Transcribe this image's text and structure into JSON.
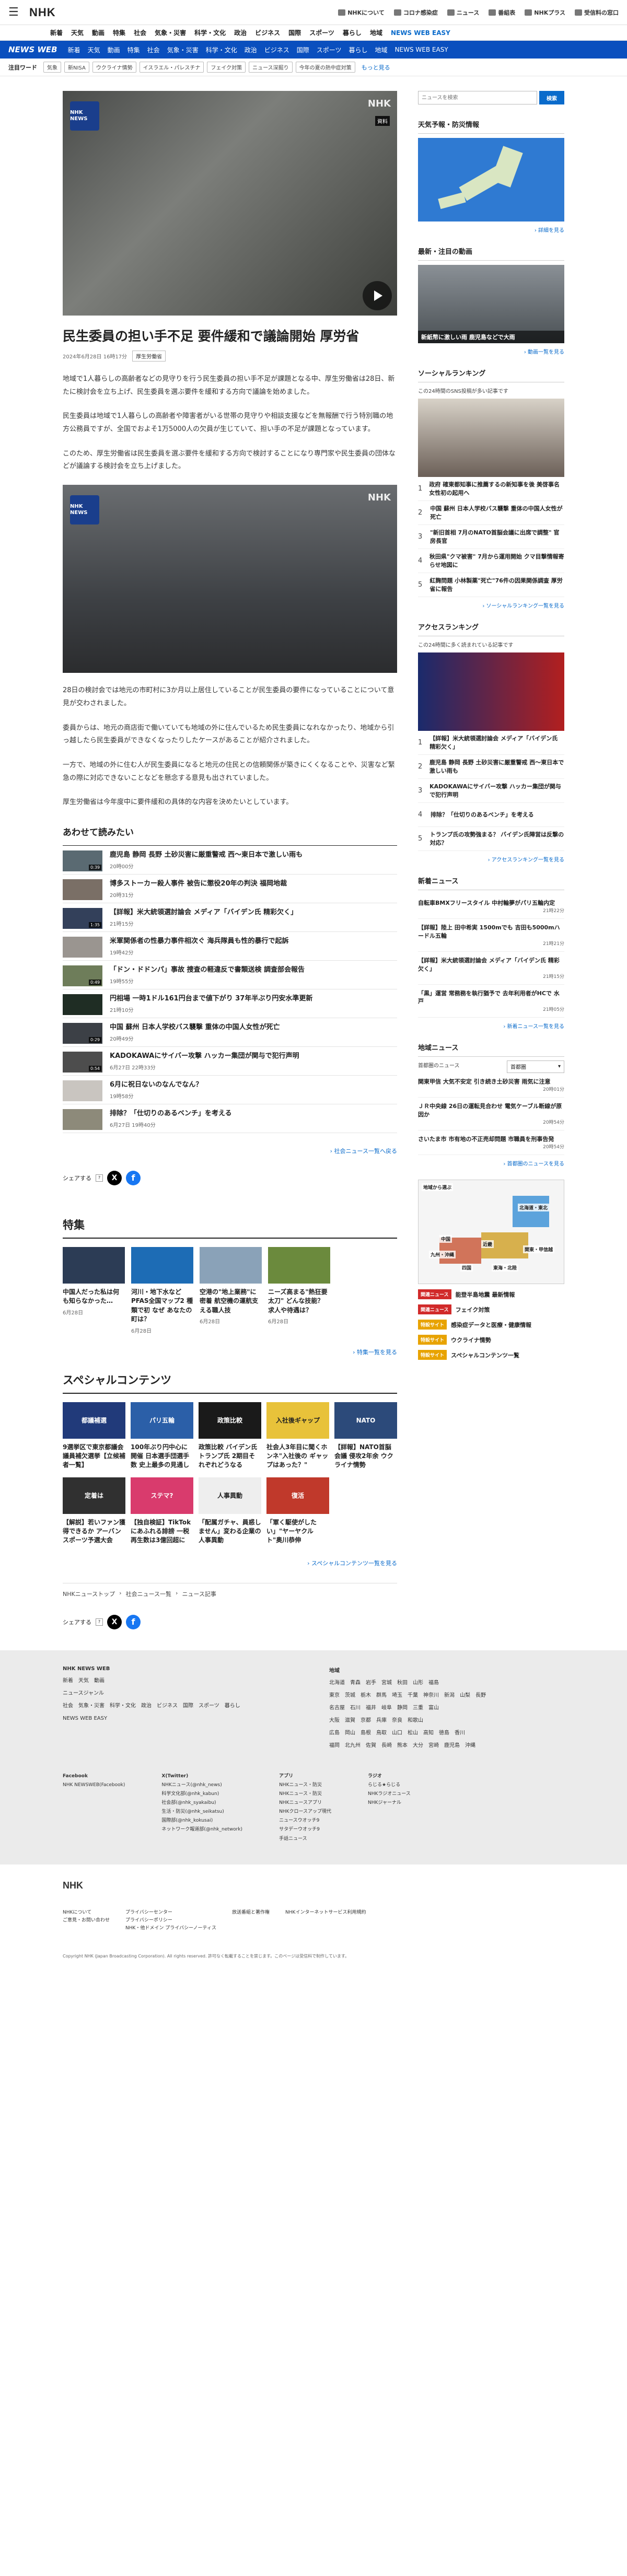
{
  "header": {
    "logo": "NHK",
    "links": [
      "NHKについて",
      "コロナ感染症",
      "ニュース",
      "番組表",
      "NHKプラス",
      "受信料の窓口"
    ]
  },
  "nav": {
    "items": [
      "新着",
      "天気",
      "動画",
      "特集",
      "社会",
      "気象・災害",
      "科学・文化",
      "政治",
      "ビジネス",
      "国際",
      "スポーツ",
      "暮らし",
      "地域",
      "NEWS WEB EASY"
    ]
  },
  "newsweb": {
    "logo": "NEWS WEB",
    "items": [
      "新着",
      "天気",
      "動画",
      "特集",
      "社会",
      "気象・災害",
      "科学・文化",
      "政治",
      "ビジネス",
      "国際",
      "スポーツ",
      "暮らし",
      "地域",
      "NEWS WEB EASY"
    ]
  },
  "attention": {
    "label": "注目ワード",
    "tags": [
      "気象",
      "新NISA",
      "ウクライナ情勢",
      "イスラエル・パレスチナ",
      "フェイク対策",
      "ニュース深掘り",
      "今年の夏の熱中症対策"
    ],
    "more": "もっと見る"
  },
  "article": {
    "watermark": "NHK",
    "badge": "資料",
    "nhk_badge": "NHK NEWS",
    "title": "民生委員の担い手不足 要件緩和で議論開始 厚労省",
    "date": "2024年6月28日 16時17分",
    "category": "厚生労働省",
    "paragraphs": [
      "地域で1人暮らしの高齢者などの見守りを行う民生委員の担い手不足が課題となる中、厚生労働省は28日、新たに検討会を立ち上げ、民生委員を選ぶ要件を緩和する方向で議論を始めました。",
      "民生委員は地域で1人暮らしの高齢者や障害者がいる世帯の見守りや相談支援などを無報酬で行う特別職の地方公務員ですが、全国でおよそ1万5000人の欠員が生じていて、担い手の不足が課題となっています。",
      "このため、厚生労働省は民生委員を選ぶ要件を緩和する方向で検討することになり専門家や民生委員の団体などが議論する検討会を立ち上げました。",
      "28日の検討会では地元の市町村に3か月以上居住していることが民生委員の要件になっていることについて意見が交わされました。",
      "委員からは、地元の商店街で働いていても地域の外に住んでいるため民生委員になれなかったり、地域から引っ越したら民生委員ができなくなったりしたケースがあることが紹介されました。",
      "一方で、地域の外に住む人が民生委員になると地元の住民との信頼関係が築きにくくなることや、災害など緊急の際に対応できないことなどを懸念する意見も出されていました。",
      "厚生労働省は今年度中に要件緩和の具体的な内容を決めたいとしています。"
    ]
  },
  "related": {
    "heading": "あわせて読みたい",
    "items": [
      {
        "title": "鹿児島 静岡 長野 土砂災害に厳重警戒 西～東日本で激しい雨も",
        "date": "20時00分",
        "dur": "0:39"
      },
      {
        "title": "博多ストーカー殺人事件 被告に懲役20年の判決 福岡地裁",
        "date": "20時31分",
        "dur": ""
      },
      {
        "title": "【詳報】米大統領選討論会 メディア「バイデン氏 精彩欠く」",
        "date": "21時15分",
        "dur": "1:35"
      },
      {
        "title": "米軍関係者の性暴力事件相次ぐ 海兵隊員も性的暴行で起訴",
        "date": "19時42分",
        "dur": ""
      },
      {
        "title": "「ドン・ドドンパ」事故 捜査の軽違反で書類送検 調査部会報告",
        "date": "19時55分",
        "dur": "0:49"
      },
      {
        "title": "円相場 一時1ドル161円台まで値下がり 37年半ぶり円安水準更新",
        "date": "21時10分",
        "dur": ""
      },
      {
        "title": "中国 蘇州 日本人学校バス襲撃 重体の中国人女性が死亡",
        "date": "20時49分",
        "dur": "0:29"
      },
      {
        "title": "KADOKAWAにサイバー攻撃 ハッカー集団が関与で犯行声明",
        "date": "6月27日 22時33分",
        "dur": "0:54"
      },
      {
        "title": "6月に祝日ないのなんでなん？",
        "date": "19時58分",
        "dur": ""
      },
      {
        "title": "排除？「仕切りのあるベンチ」を考える",
        "date": "6月27日 19時40分",
        "dur": ""
      }
    ],
    "more": "社会ニュース一覧へ戻る"
  },
  "share": {
    "label": "シェアする"
  },
  "tokushu": {
    "heading": "特集",
    "items": [
      {
        "title": "中国人だった私は何も知らなかった…",
        "date": "6月28日",
        "thumb": "中国"
      },
      {
        "title": "河川・地下水など PFAS全国マップ2 種類で初 なぜ あなたの町は？",
        "date": "6月28日",
        "thumb": "PFAS汚染"
      },
      {
        "title": "空港の\"地上業務\"に密着 航空機の運航支える職人技",
        "date": "6月28日",
        "thumb": "空港"
      },
      {
        "title": "ニーズ高まる\"熱狂要太刀\" どんな技能？ 求人や待遇は？",
        "date": "6月28日",
        "thumb": "熱狂"
      }
    ],
    "more": "特集一覧を見る"
  },
  "special": {
    "heading": "スペシャルコンテンツ",
    "items": [
      {
        "title": "9選挙区で東京都議会議員補欠選挙【立候補者一覧】",
        "thumb": "都議補選"
      },
      {
        "title": "100年ぶり円中心に開催 日本選手団選手数 史上最多の見通し",
        "thumb": "パリ五輪"
      },
      {
        "title": "政策比較 バイデン氏トランプ氏 2期目それぞれどうなる",
        "thumb": "政策比較"
      },
      {
        "title": "社会人3年目に聞くホンネ\"入社後の ギャップはあった？\"",
        "thumb": "入社後ギャップ"
      },
      {
        "title": "【詳報】NATO首脳会議 侵攻2年余 ウクライナ情勢",
        "thumb": "NATO"
      },
      {
        "title": "【解説】若いファン獲得できるか アーバンスポーツ予選大会",
        "thumb": "定着は"
      },
      {
        "title": "【独自検証】TikTokにあふれる誹謗 一税再生数は3億回超に",
        "thumb": "ステマ?"
      },
      {
        "title": "「配属ガチャ、員惑しません」変わる企業の人事異動",
        "thumb": "人事異動"
      },
      {
        "title": "「軍く駆使がしたい」\"ヤーヤクルト\"奥川恭伸",
        "thumb": "復活"
      },
      {
        "title": "",
        "thumb": ""
      }
    ],
    "more": "スペシャルコンテンツ一覧を見る"
  },
  "breadcrumb": [
    "NHKニューストップ",
    "社会ニュース一覧",
    "ニュース記事"
  ],
  "sidebar": {
    "search_placeholder": "ニュースを検索",
    "search_button": "検索",
    "weather_h": "天気予報・防災情報",
    "weather_more": "詳細を見る",
    "video_h": "最新・注目の動画",
    "video_caption": "新紙幣に激しい雨 鹿児島などで大雨",
    "video_more": "動画一覧を見る",
    "social_h": "ソーシャルランキング",
    "social_sub": "この24時間のSNS投稿が多い記事です",
    "social_items": [
      "政府 確東都知事に推薦するの新知事を後 美啓事名 女性初の起用へ",
      "中国 蘇州 日本人学校バス襲撃 重体の中国人女性が死亡",
      "\"新旧首相 7月のNATO首脳会議に出席で調整\" 官房長官",
      "秋田県\"クマ被害\" 7月から運用開始 クマ目撃情報寄らせ地図に",
      "紅麹問題 小林製薬\"死亡\"76件の因果関係調査 厚労省に報告"
    ],
    "social_more": "ソーシャルランキング一覧を見る",
    "access_h": "アクセスランキング",
    "access_sub": "この24時間に多く読まれている記事です",
    "access_items": [
      "【詳報】米大統領選討論会 メディア「バイデン氏 精彩欠く」",
      "鹿児島 静岡 長野 土砂災害に厳重警戒 西～東日本で激しい雨も",
      "KADOKAWAにサイバー攻撃 ハッカー集団が関与で犯行声明",
      "排除？「仕切りのあるベンチ」を考える",
      "トランプ氏の攻勢強まる？ バイデン氏陣営は反撃の対応？"
    ],
    "access_more": "アクセスランキング一覧を見る",
    "new_h": "新着ニュース",
    "new_items": [
      {
        "t": "自転車BMXフリースタイル 中村輪夢がパリ五輪内定",
        "d": "21時22分"
      },
      {
        "t": "【詳報】陸上 田中希実 1500mでも 吉田も5000mハードル五輪",
        "d": "21時21分"
      },
      {
        "t": "【詳報】米大統領選討論会 メディア「バイデン氏 精彩欠く」",
        "d": "21時15分"
      },
      {
        "t": "「黒」運営 常務務を執行猶予で 去年利用者がHCで 水戸",
        "d": "21時05分"
      }
    ],
    "new_more": "新着ニュース一覧を見る",
    "region_h": "地域ニュース",
    "region_select": "首都圏",
    "region_sub": "首都圏のニュース",
    "region_items": [
      {
        "t": "関東甲信 大気不安定 引き続き土砂災害 雨気に注意",
        "d": "20時01分"
      },
      {
        "t": "ＪＲ中央線 26日の運転見合わせ 電気ケーブル断線が原因か",
        "d": "20時54分"
      },
      {
        "t": "さいたま市 市有地の不正売却問題 市職員を刑事告発",
        "d": "20時54分"
      }
    ],
    "region_more": "首都圏のニュースを見る",
    "map_h": "地域から選ぶ",
    "map_regions": [
      "北海道・東北",
      "中国",
      "九州・沖縄",
      "四国",
      "近畿",
      "東海・北陸",
      "関東・甲信越"
    ],
    "banners": [
      {
        "badge": "関連ニュース",
        "text": "能登半島地震 最新情報",
        "red": true
      },
      {
        "badge": "関連ニュース",
        "text": "フェイク対策",
        "red": true
      },
      {
        "badge": "特設サイト",
        "text": "感染症データと医療・健康情報",
        "red": false
      },
      {
        "badge": "特設サイト",
        "text": "ウクライナ情勢",
        "red": false
      },
      {
        "badge": "特設サイト",
        "text": "スペシャルコンテンツ一覧",
        "red": false
      }
    ]
  },
  "footer": {
    "left_h": "NHK NEWS WEB",
    "left_rows": [
      "新着　天気　動画",
      "ニュースジャンル",
      "社会　気象・災害　科学・文化　政治　ビジネス　国際　スポーツ　暮らし",
      "NEWS WEB EASY"
    ],
    "right_h": "地域",
    "right_rows": [
      "北海道　青森　岩手　宮城　秋田　山形　福島",
      "東京　茨城　栃木　群馬　埼玉　千葉　神奈川　新潟　山梨　長野",
      "名古屋　石川　福井　岐阜　静岡　三重　富山",
      "大阪　滋賀　京都　兵庫　奈良　和歌山",
      "広島　岡山　島根　鳥取　山口　松山　高知　徳島　香川",
      "福岡　北九州　佐賀　長崎　熊本　大分　宮崎　鹿児島　沖縄"
    ],
    "bottom_cols": [
      [
        "Facebook",
        "NHK NEWSWEB(Facebook)"
      ],
      [
        "X(Twitter)",
        "NHKニュース(@nhk_news)",
        "科学文化部(@nhk_kabun)",
        "社会部(@nhk_syakaibu)",
        "生活・防災(@nhk_seikatsu)",
        "国際部(@nhk_kokusai)",
        "ネットワーク報道部(@nhk_network)"
      ],
      [
        "アプリ",
        "NHKニュース・防災",
        "NHKニュース・防災",
        "NHKニュースアプリ",
        "NHKクロースアップ現代",
        "ニュースウオッチ9",
        "サタデーウオッチ9",
        "手話ニュース"
      ],
      [
        "ラジオ",
        "らじる★らじる",
        "NHKラジオニュース",
        "NHKジャーナル"
      ]
    ],
    "legal_logo": "NHK",
    "legal_rows": [
      [
        "NHKについて",
        "ご意見・お問い合わせ"
      ],
      [
        "プライバシーセンター",
        "プライバシーポリシー",
        "NHK・他ドメイン プライバシーノーティス"
      ],
      [
        "放送番組と著作権",
        "NHKインターネットサービス利用規約"
      ]
    ],
    "copyright": "Copyright NHK (Japan Broadcasting Corporation). All rights reserved. 許可なく転載することを禁じます。このページは受信料で制作しています。"
  }
}
